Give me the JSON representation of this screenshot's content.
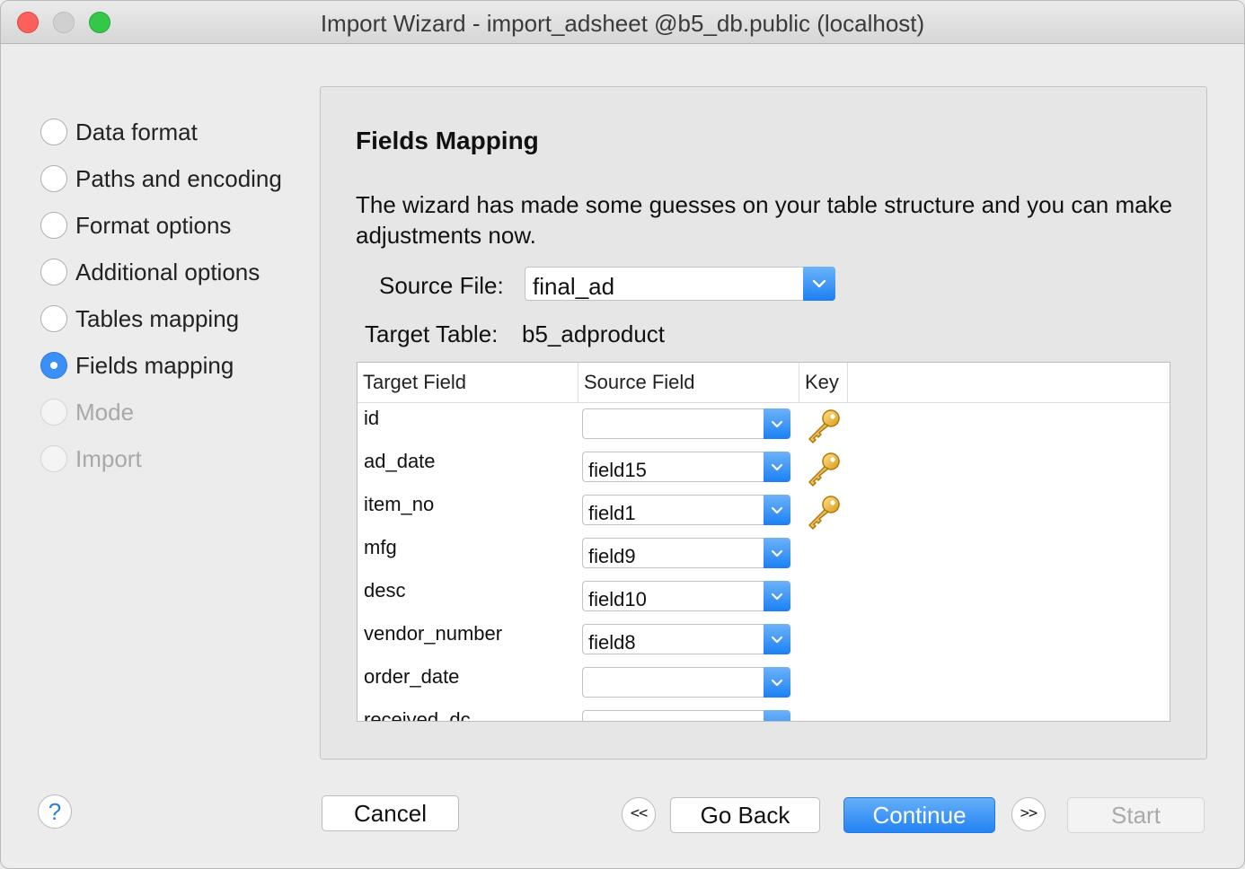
{
  "window": {
    "title": "Import Wizard - import_adsheet @b5_db.public (localhost)"
  },
  "steps": [
    {
      "label": "Data format",
      "state": "normal"
    },
    {
      "label": "Paths and encoding",
      "state": "normal"
    },
    {
      "label": "Format options",
      "state": "normal"
    },
    {
      "label": "Additional options",
      "state": "normal"
    },
    {
      "label": "Tables mapping",
      "state": "normal"
    },
    {
      "label": "Fields mapping",
      "state": "active"
    },
    {
      "label": "Mode",
      "state": "disabled"
    },
    {
      "label": "Import",
      "state": "disabled"
    }
  ],
  "panel": {
    "title": "Fields Mapping",
    "description": "The wizard has made some guesses on your table structure and you can make adjustments now.",
    "source_file_label": "Source File:",
    "source_file_value": "final_ad",
    "target_table_label": "Target Table:",
    "target_table_value": "b5_adproduct"
  },
  "table": {
    "headers": [
      "Target Field",
      "Source Field",
      "Key"
    ],
    "rows": [
      {
        "target": "id",
        "source": "",
        "key": true
      },
      {
        "target": "ad_date",
        "source": "field15",
        "key": true
      },
      {
        "target": "item_no",
        "source": "field1",
        "key": true
      },
      {
        "target": "mfg",
        "source": "field9",
        "key": false
      },
      {
        "target": "desc",
        "source": "field10",
        "key": false
      },
      {
        "target": "vendor_number",
        "source": "field8",
        "key": false
      },
      {
        "target": "order_date",
        "source": "",
        "key": false
      },
      {
        "target": "received_dc",
        "source": "",
        "key": false
      }
    ]
  },
  "buttons": {
    "help": "?",
    "cancel": "Cancel",
    "first": "<<",
    "back": "Go Back",
    "continue": "Continue",
    "last": ">>",
    "start": "Start"
  },
  "colors": {
    "accent": "#2283f3",
    "key_gold": "#e8b82f"
  }
}
